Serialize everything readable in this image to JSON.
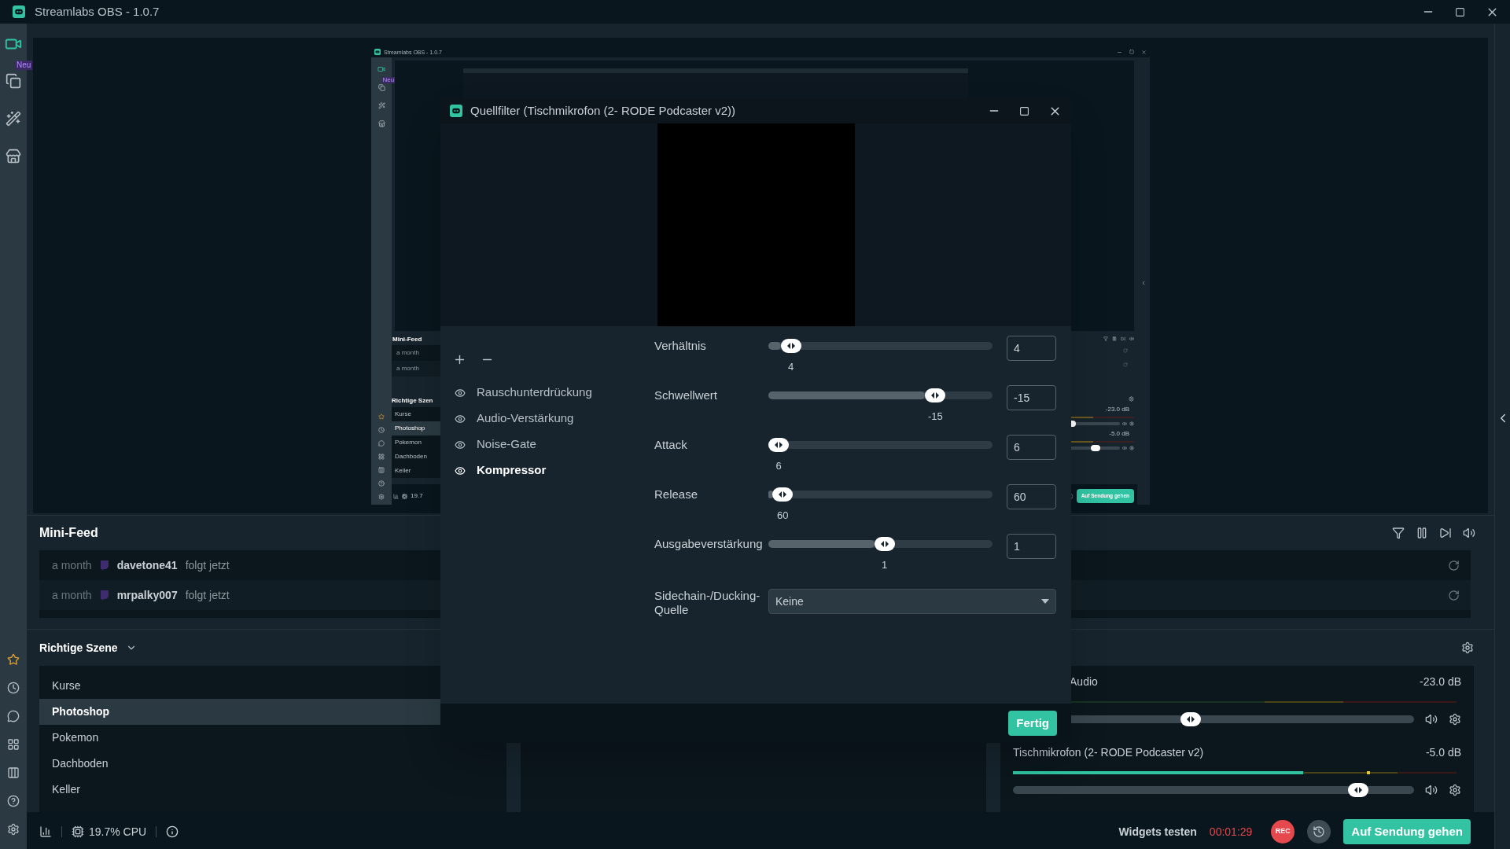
{
  "window": {
    "title": "Streamlabs OBS - 1.0.7"
  },
  "nav": {
    "badge": "Neu"
  },
  "preview": {
    "title": "Streamlabs OBS - 1.0.7",
    "badge": "Neu",
    "mini_feed_title": "Mini-Feed",
    "feed_times": [
      "a month",
      "a month"
    ],
    "scene_title": "Richtige Szen",
    "scenes": [
      {
        "name": "Kurse",
        "selected": false
      },
      {
        "name": "Photoshop",
        "selected": true
      },
      {
        "name": "Pokemon",
        "selected": false
      },
      {
        "name": "Dachboden",
        "selected": false
      },
      {
        "name": "Keller",
        "selected": false
      }
    ],
    "cpu": "19.7",
    "channels": [
      {
        "reading": "-23.0 dB",
        "level": 0.0
      },
      {
        "reading": "-5.0 dB",
        "level": 0.55
      }
    ],
    "go_live": "Auf Sendung gehen"
  },
  "mini_feed": {
    "title": "Mini-Feed",
    "events": [
      {
        "time": "a month",
        "user": "davetone41",
        "action": "folgt jetzt"
      },
      {
        "time": "a month",
        "user": "mrpalky007",
        "action": "folgt jetzt"
      }
    ]
  },
  "scenes": {
    "title": "Richtige Szene",
    "items": [
      {
        "name": "Kurse",
        "selected": false
      },
      {
        "name": "Photoshop",
        "selected": true
      },
      {
        "name": "Pokemon",
        "selected": false
      },
      {
        "name": "Dachboden",
        "selected": false
      },
      {
        "name": "Keller",
        "selected": false
      }
    ]
  },
  "mixer": {
    "channels": [
      {
        "name": "Audio",
        "reading": "-23.0 dB",
        "level": 0.44
      },
      {
        "name": "Tischmikrofon (2- RODE Podcaster v2)",
        "reading": "-5.0 dB",
        "level": 0.88
      }
    ]
  },
  "status_bar": {
    "cpu": "19.7% CPU",
    "test_widgets": "Widgets testen",
    "timer": "00:01:29",
    "rec": "REC",
    "go_live": "Auf Sendung gehen"
  },
  "dialog": {
    "title": "Quellfilter (Tischmikrofon (2- RODE Podcaster v2))",
    "filters": [
      {
        "name": "Rauschunterdrückung",
        "selected": false
      },
      {
        "name": "Audio-Verstärkung",
        "selected": false
      },
      {
        "name": "Noise-Gate",
        "selected": false
      },
      {
        "name": "Kompressor",
        "selected": true
      }
    ],
    "settings": [
      {
        "kind": "slider",
        "label": "Verhältnis",
        "level": 0.06,
        "reading": "4",
        "value": "4"
      },
      {
        "kind": "slider",
        "label": "Schwellwert",
        "level": 0.77,
        "reading": "-15",
        "value": "-15"
      },
      {
        "kind": "slider",
        "label": "Attack",
        "level": 0,
        "reading": "6",
        "value": "6"
      },
      {
        "kind": "slider",
        "label": "Release",
        "level": 0.02,
        "reading": "60",
        "value": "60"
      },
      {
        "kind": "slider",
        "label": "Ausgabeverstärkung",
        "level": 0.52,
        "reading": "1",
        "value": "1"
      },
      {
        "kind": "select",
        "label": "Sidechain-/Ducking-Quelle",
        "value": "Keine"
      }
    ],
    "done": "Fertig"
  }
}
